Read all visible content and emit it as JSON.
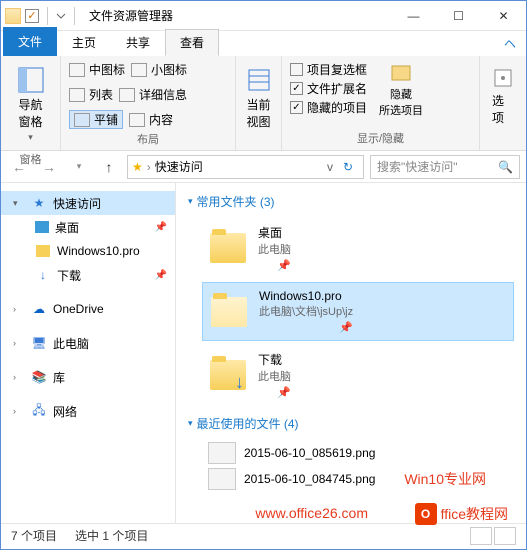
{
  "title": "文件资源管理器",
  "tabs": {
    "file": "文件",
    "home": "主页",
    "share": "共享",
    "view": "查看"
  },
  "ribbon": {
    "panes": {
      "nav": "导航窗格",
      "group": "窗格"
    },
    "layout": {
      "medium": "中图标",
      "small": "小图标",
      "list": "列表",
      "details": "详细信息",
      "tiles": "平铺",
      "content": "内容",
      "group": "布局"
    },
    "current": {
      "label": "当前\n视图",
      "group": "当前视图"
    },
    "showhide": {
      "checkboxes": "项目复选框",
      "ext": "文件扩展名",
      "hidden": "隐藏的项目",
      "hide": "隐藏\n所选项目",
      "group": "显示/隐藏"
    },
    "options": "选项"
  },
  "address": {
    "location": "快速访问",
    "search_placeholder": "搜索\"快速访问\""
  },
  "nav": {
    "quick": "快速访问",
    "desktop": "桌面",
    "win10": "Windows10.pro",
    "downloads": "下载",
    "onedrive": "OneDrive",
    "thispc": "此电脑",
    "libraries": "库",
    "network": "网络"
  },
  "content": {
    "freq_hdr": "常用文件夹 (3)",
    "recent_hdr": "最近使用的文件 (4)",
    "tiles": [
      {
        "name": "桌面",
        "sub": "此电脑"
      },
      {
        "name": "Windows10.pro",
        "sub": "此电脑\\文档\\jsUp\\jz"
      },
      {
        "name": "下载",
        "sub": "此电脑"
      }
    ],
    "recent": [
      {
        "name": "2015-06-10_085619.png"
      },
      {
        "name": "2015-06-10_084745.png"
      }
    ]
  },
  "status": {
    "count": "7 个项目",
    "selected": "选中 1 个项目"
  },
  "watermark": {
    "line1": "Win10专业网",
    "line2": "www.office26.com",
    "badge": "ffice教程网"
  }
}
